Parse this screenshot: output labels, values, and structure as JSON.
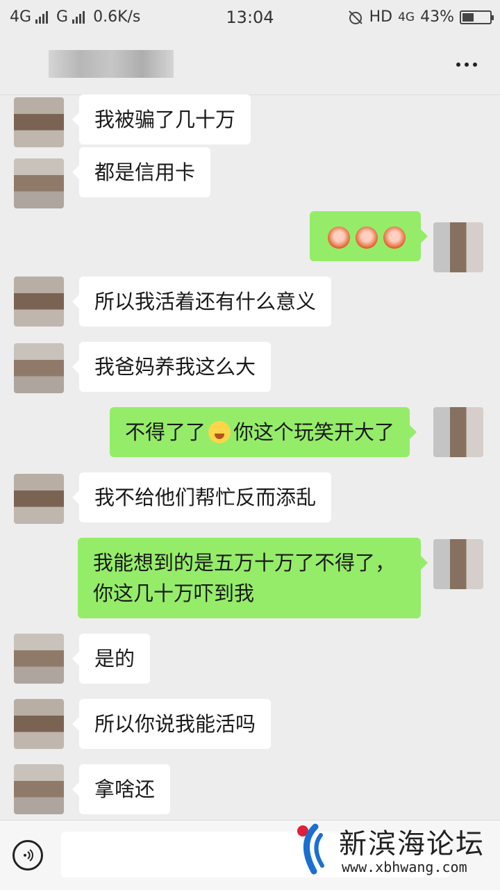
{
  "status_bar": {
    "net1": "4G",
    "net2": "G",
    "speed": "0.6K/s",
    "time": "13:04",
    "hd": "HD",
    "net3": "4G",
    "battery": "43%",
    "battery_level": 0.43
  },
  "messages": [
    {
      "side": "in",
      "text": "我被骗了几十万"
    },
    {
      "side": "in",
      "text": "都是信用卡"
    },
    {
      "side": "out",
      "emoji": [
        "angry-face",
        "angry-face",
        "angry-face"
      ]
    },
    {
      "side": "in",
      "text": "所以我活着还有什么意义"
    },
    {
      "side": "in",
      "text": "我爸妈养我这么大"
    },
    {
      "side": "out",
      "text_a": "不得了了",
      "emoji": [
        "crying-face"
      ],
      "text_b": "你这个玩笑开大了"
    },
    {
      "side": "in",
      "text": "我不给他们帮忙反而添乱"
    },
    {
      "side": "out",
      "line1": "我能想到的是五万十万了不得了，",
      "line2": "你这几十万吓到我"
    },
    {
      "side": "in",
      "text": "是的"
    },
    {
      "side": "in",
      "text": "所以你说我能活吗"
    },
    {
      "side": "in",
      "text": "拿啥还"
    }
  ],
  "watermark": {
    "title": "新滨海论坛",
    "url": "www.xbhwang.com"
  },
  "colors": {
    "background": "#ededed",
    "incoming_bubble": "#ffffff",
    "outgoing_bubble": "#95ec69"
  }
}
